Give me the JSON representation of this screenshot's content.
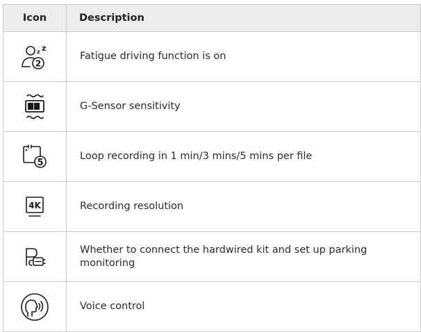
{
  "table": {
    "headers": {
      "icon": "Icon",
      "description": "Description"
    },
    "rows": [
      {
        "icon": "fatigue-driving-icon",
        "description": "Fatigue driving function is on",
        "badge": "2"
      },
      {
        "icon": "g-sensor-icon",
        "description": "G-Sensor sensitivity"
      },
      {
        "icon": "loop-recording-icon",
        "description": "Loop recording in 1 min/3 mins/5 mins per file",
        "badge": "5"
      },
      {
        "icon": "resolution-4k-icon",
        "description": "Recording resolution",
        "badge": "4K"
      },
      {
        "icon": "parking-monitoring-icon",
        "description": "Whether to connect the hardwired kit and set up parking monitoring"
      },
      {
        "icon": "voice-control-icon",
        "description": "Voice control"
      }
    ]
  }
}
